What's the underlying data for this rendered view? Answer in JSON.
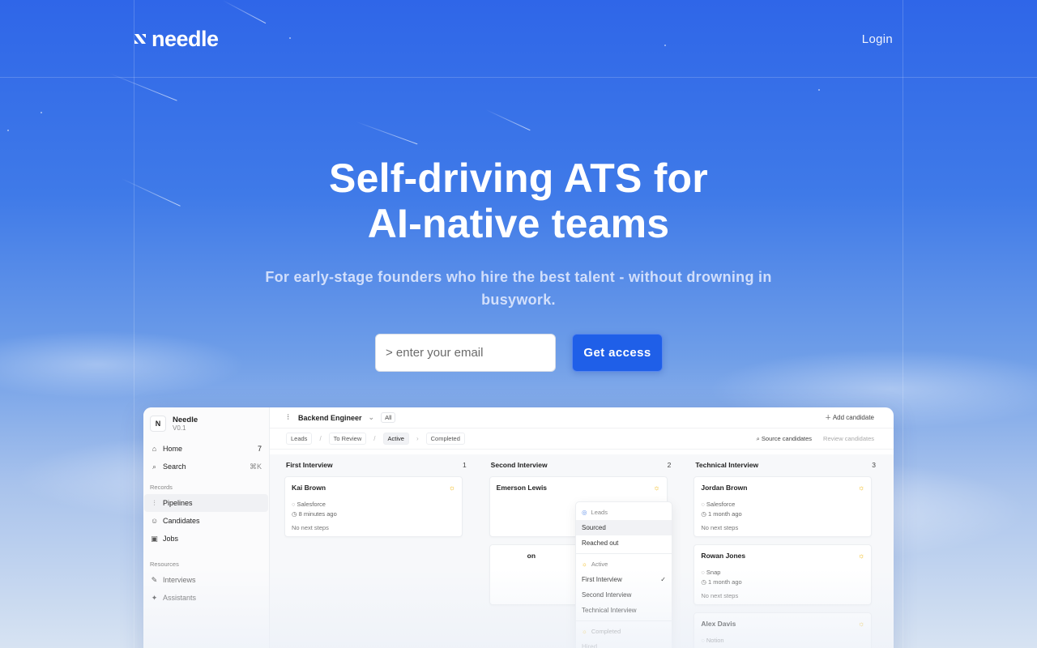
{
  "nav": {
    "brand": "needle",
    "login_label": "Login"
  },
  "hero": {
    "title_line1": "Self-driving ATS for",
    "title_line2": "AI-native teams",
    "subtitle": "For early-stage founders who hire the best talent - without drowning in busywork."
  },
  "signup": {
    "email_placeholder": "> enter your email",
    "cta_label": "Get access"
  },
  "app": {
    "workspace": {
      "name": "Needle",
      "version": "V0.1"
    },
    "sidebar": {
      "home": "Home",
      "home_count": "7",
      "search": "Search",
      "search_shortcut": "⌘K",
      "records_label": "Records",
      "items": [
        "Pipelines",
        "Candidates",
        "Jobs"
      ],
      "resources_label": "Resources",
      "resources": [
        "Interviews",
        "Assistants"
      ]
    },
    "header": {
      "job": "Backend Engineer",
      "filter": "All",
      "add_label": "Add candidate"
    },
    "tabs": [
      "Leads",
      "To Review",
      "Active",
      "Completed"
    ],
    "actions": {
      "source": "Source candidates",
      "review": "Review candidates"
    },
    "columns": [
      {
        "title": "First Interview",
        "count": "1",
        "cards": [
          {
            "name": "Kai Brown",
            "source": "Salesforce",
            "time": "8 minutes ago",
            "next": "No next steps"
          }
        ]
      },
      {
        "title": "Second Interview",
        "count": "2",
        "cards": [
          {
            "name": "Emerson Lewis",
            "source": "",
            "time": "",
            "next": ""
          },
          {
            "name": "on",
            "source": "",
            "time": "",
            "next": ""
          }
        ]
      },
      {
        "title": "Technical Interview",
        "count": "3",
        "cards": [
          {
            "name": "Jordan Brown",
            "source": "Salesforce",
            "time": "1 month ago",
            "next": "No next steps"
          },
          {
            "name": "Rowan Jones",
            "source": "Snap",
            "time": "1 month ago",
            "next": "No next steps"
          },
          {
            "name": "Alex Davis",
            "source": "Notion",
            "time": "",
            "next": ""
          }
        ]
      }
    ],
    "dropdown": {
      "leads_header": "Leads",
      "leads": [
        "Sourced",
        "Reached out"
      ],
      "active_header": "Active",
      "active": [
        "First Interview",
        "Second Interview",
        "Technical Interview"
      ],
      "completed_header": "Completed",
      "completed": [
        "Hired"
      ]
    }
  }
}
